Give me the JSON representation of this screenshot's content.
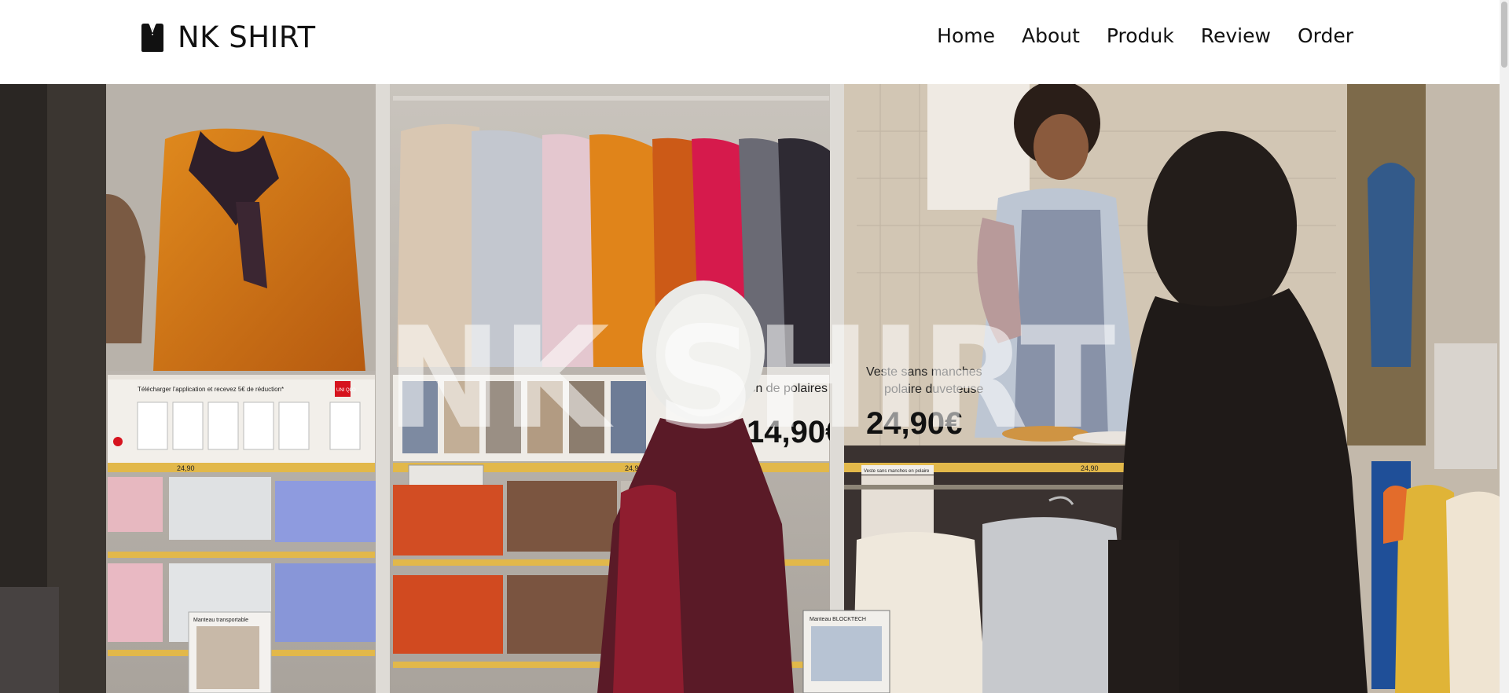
{
  "header": {
    "logo_icon": "shirt-icon",
    "brand": "NK SHIRT",
    "nav": [
      {
        "label": "Home"
      },
      {
        "label": "About"
      },
      {
        "label": "Produk"
      },
      {
        "label": "Review"
      },
      {
        "label": "Order"
      }
    ]
  },
  "hero": {
    "title": "NK SHIRT",
    "image": "clothing-store-photo",
    "signage": {
      "uniqlo": "UNI QLO",
      "poster_left_text": "Télécharger l'application et recevez 5€ de réduction*",
      "poster_mid_text": "Collection de polaires",
      "price_mid": "14,90€",
      "poster_right_text_1": "Veste sans manches",
      "poster_right_text_2": "polaire duveteuse",
      "price_right": "24,90€",
      "shelf_price_1": "24,90",
      "shelf_price_2": "24,90",
      "shelf_price_3": "24,90",
      "shelf_label_right": "Veste sans manches en polaire",
      "sign_bottom_left": "Manteau transportable",
      "sign_bottom_mid": "Manteau BLOCKTECH"
    }
  },
  "colors": {
    "header_bg": "#ffffff",
    "text": "#111111"
  }
}
